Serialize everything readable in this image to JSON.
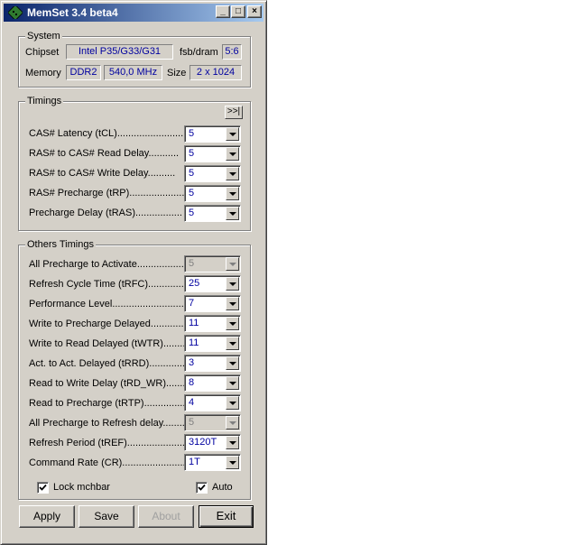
{
  "window": {
    "title": "MemSet 3.4 beta4",
    "minimize": "_",
    "maximize": "□",
    "close": "×"
  },
  "system": {
    "label": "System",
    "chipset_label": "Chipset",
    "chipset": "Intel P35/G33/G31",
    "fsbdram_label": "fsb/dram",
    "fsbdram": "5:6",
    "memory_label": "Memory",
    "memory_type": "DDR2",
    "memory_freq": "540,0 MHz",
    "size_label": "Size",
    "size": "2 x 1024"
  },
  "timings": {
    "label": "Timings",
    "expand_button": ">>|",
    "rows": [
      {
        "label": "CAS# Latency (tCL).........................",
        "value": "5"
      },
      {
        "label": "RAS# to CAS# Read Delay...........",
        "value": "5"
      },
      {
        "label": "RAS# to CAS# Write Delay..........",
        "value": "5"
      },
      {
        "label": "RAS# Precharge (tRP)....................",
        "value": "5"
      },
      {
        "label": "Precharge Delay  (tRAS).................",
        "value": "5"
      }
    ]
  },
  "others": {
    "label": "Others Timings",
    "rows": [
      {
        "label": "All Precharge to Activate..................",
        "value": "5"
      },
      {
        "label": "Refresh Cycle Time (tRFC)...............",
        "value": "25"
      },
      {
        "label": "Performance Level..............................",
        "value": "7"
      },
      {
        "label": "Write to Precharge Delayed..............",
        "value": "11"
      },
      {
        "label": "Write to Read Delayed (tWTR).........",
        "value": "11"
      },
      {
        "label": "Act. to Act. Delayed (tRRD)..............",
        "value": "3"
      },
      {
        "label": "Read to Write Delay (tRD_WR)........",
        "value": "8"
      },
      {
        "label": "Read to Precharge (tRTP)..................",
        "value": "4"
      },
      {
        "label": "All Precharge to Refresh delay.........",
        "value": "5"
      },
      {
        "label": "Refresh Period (tREF)......................",
        "value": "3120T"
      },
      {
        "label": "Command Rate (CR).........................",
        "value": "1T"
      }
    ],
    "lock_label": "Lock mchbar",
    "auto_label": "Auto"
  },
  "buttons": {
    "apply": "Apply",
    "save": "Save",
    "about": "About",
    "exit": "Exit"
  }
}
